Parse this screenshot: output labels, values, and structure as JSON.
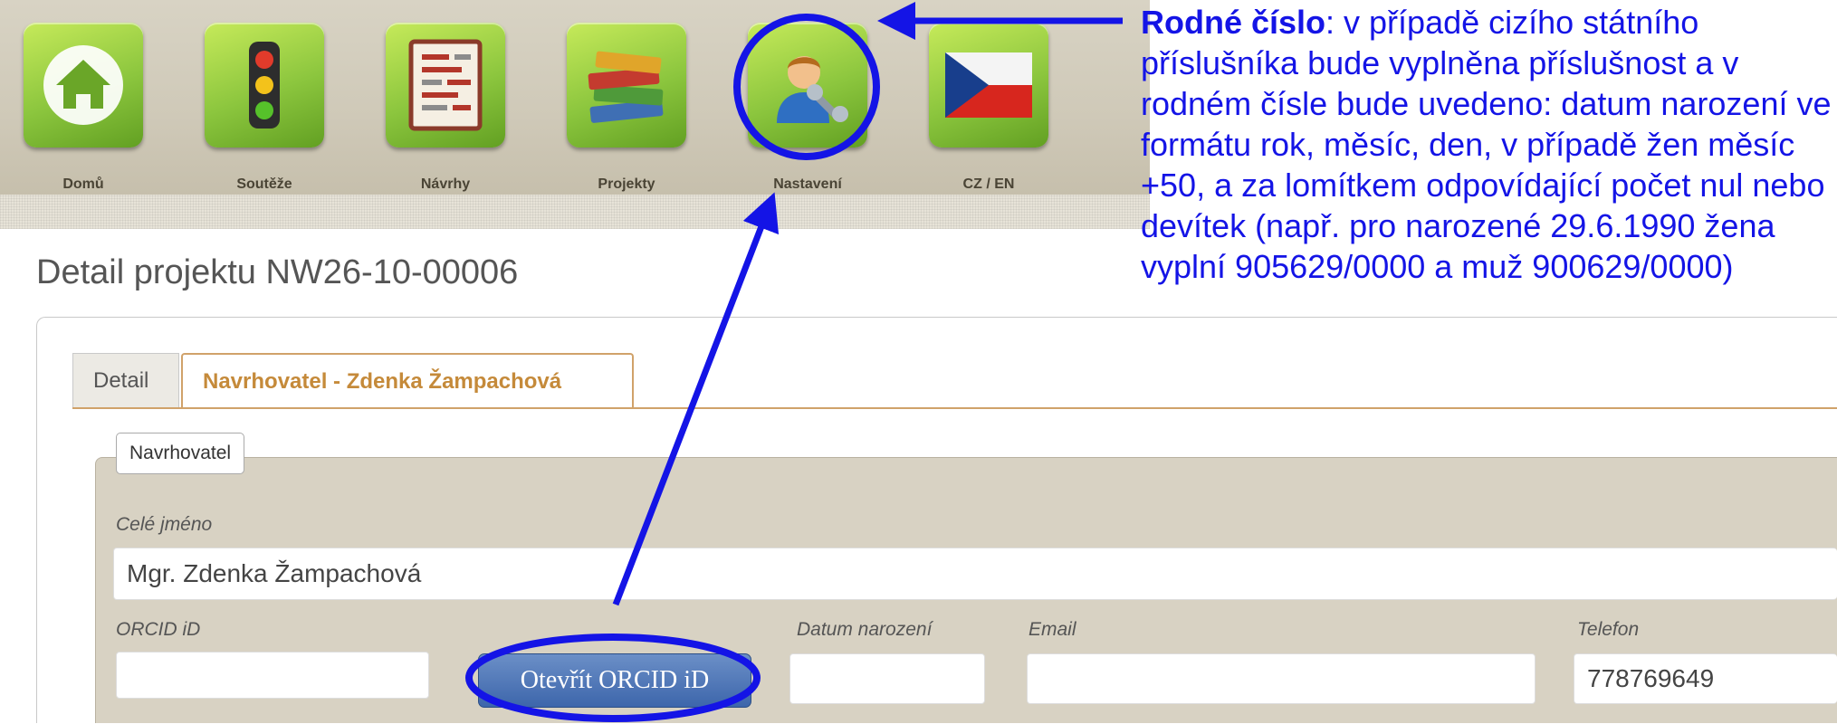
{
  "nav": {
    "items": [
      {
        "label": "Domů",
        "icon": "home-icon"
      },
      {
        "label": "Soutěže",
        "icon": "traffic-light-icon"
      },
      {
        "label": "Návrhy",
        "icon": "document-list-icon"
      },
      {
        "label": "Projekty",
        "icon": "books-icon"
      },
      {
        "label": "Nastavení",
        "icon": "user-settings-icon"
      },
      {
        "label": "CZ / EN",
        "icon": "czech-flag-icon"
      }
    ]
  },
  "page": {
    "title": "Detail projektu NW26-10-00006"
  },
  "tabs": [
    {
      "label": "Detail",
      "active": false
    },
    {
      "label": "Navrhovatel - Zdenka Žampachová",
      "active": true
    }
  ],
  "form": {
    "legend": "Navrhovatel",
    "full_name_label": "Celé jméno",
    "full_name_value": "Mgr. Zdenka Žampachová",
    "orcid_label": "ORCID iD",
    "orcid_value": "",
    "open_orcid_button": "Otevřít ORCID iD",
    "birth_date_label": "Datum narození",
    "birth_date_value": "",
    "email_label": "Email",
    "email_value": "",
    "phone_label": "Telefon",
    "phone_value": "778769649"
  },
  "annotation": {
    "title": "Rodné číslo",
    "text": ": v případě cizího státního příslušníka bude vyplněna příslušnost a v rodném čísle bude uvedeno: datum narození ve formátu rok, měsíc, den, v případě žen měsíc +50, a za lomítkem odpovídající počet nul nebo devítek (např. pro narozené 29.6.1990 žena vyplní 905629/0000 a muž 900629/0000)",
    "color": "#1414e6"
  },
  "colors": {
    "tile_green": "#8cc63e",
    "active_tab": "#c58a3a",
    "fieldset_bg": "#d8d2c3",
    "button_blue": "#3d66ab"
  }
}
